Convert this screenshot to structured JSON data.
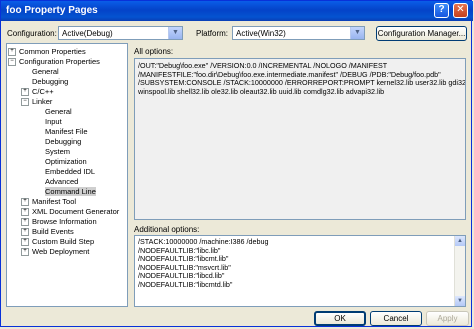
{
  "window": {
    "title": "foo Property Pages",
    "help_glyph": "?",
    "close_glyph": "✕"
  },
  "toolbar": {
    "configuration_label": "Configuration:",
    "configuration_value": "Active(Debug)",
    "platform_label": "Platform:",
    "platform_value": "Active(Win32)",
    "config_manager_label": "Configuration Manager..."
  },
  "tree": {
    "items": [
      {
        "label": "Common Properties",
        "expander": "+"
      },
      {
        "label": "Configuration Properties",
        "expander": "−"
      },
      {
        "label": "General",
        "expander": ""
      },
      {
        "label": "Debugging",
        "expander": ""
      },
      {
        "label": "C/C++",
        "expander": "+"
      },
      {
        "label": "Linker",
        "expander": "−"
      },
      {
        "label": "General",
        "expander": ""
      },
      {
        "label": "Input",
        "expander": ""
      },
      {
        "label": "Manifest File",
        "expander": ""
      },
      {
        "label": "Debugging",
        "expander": ""
      },
      {
        "label": "System",
        "expander": ""
      },
      {
        "label": "Optimization",
        "expander": ""
      },
      {
        "label": "Embedded IDL",
        "expander": ""
      },
      {
        "label": "Advanced",
        "expander": ""
      },
      {
        "label": "Command Line",
        "expander": ""
      },
      {
        "label": "Manifest Tool",
        "expander": "+"
      },
      {
        "label": "XML Document Generator",
        "expander": "+"
      },
      {
        "label": "Browse Information",
        "expander": "+"
      },
      {
        "label": "Build Events",
        "expander": "+"
      },
      {
        "label": "Custom Build Step",
        "expander": "+"
      },
      {
        "label": "Web Deployment",
        "expander": "+"
      }
    ]
  },
  "all_options": {
    "label": "All options:",
    "lines": [
      "/OUT:\"Debug\\foo.exe\" /VERSION:0.0 /INCREMENTAL /NOLOGO /MANIFEST",
      "/MANIFESTFILE:\"foo.dir\\Debug\\foo.exe.intermediate.manifest\" /DEBUG /PDB:\"Debug/foo.pdb\"",
      "/SUBSYSTEM:CONSOLE /STACK:10000000 /ERRORREPORT:PROMPT kernel32.lib user32.lib gdi32.lib",
      "winspool.lib shell32.lib ole32.lib oleaut32.lib uuid.lib comdlg32.lib advapi32.lib"
    ]
  },
  "additional_options": {
    "label": "Additional options:",
    "lines": [
      "/STACK:10000000 /machine:I386 /debug",
      "/NODEFAULTLIB:\"libc.lib\"",
      "/NODEFAULTLIB:\"libcmt.lib\"",
      "/NODEFAULTLIB:\"msvcrt.lib\"",
      "/NODEFAULTLIB:\"libcd.lib\"",
      "/NODEFAULTLIB:\"libcmtd.lib\""
    ]
  },
  "buttons": {
    "ok": "OK",
    "cancel": "Cancel",
    "apply": "Apply"
  }
}
